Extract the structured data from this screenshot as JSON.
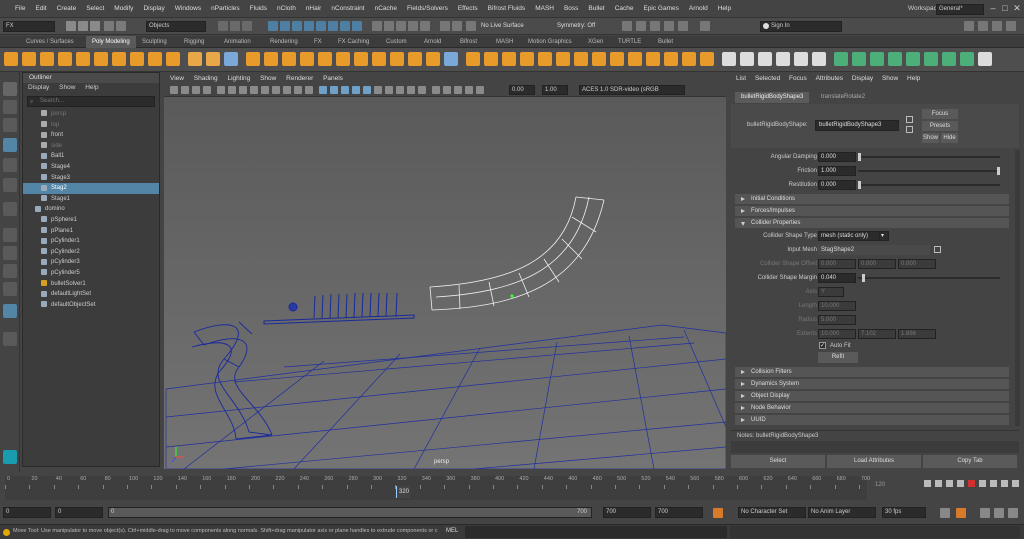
{
  "menubar": {
    "items": [
      "File",
      "Edit",
      "Create",
      "Select",
      "Modify",
      "Display",
      "Windows",
      "nParticles",
      "Fluids",
      "nCloth",
      "nHair",
      "nConstraint",
      "nCache",
      "Fields/Solvers",
      "Effects",
      "Bifrost Fluids",
      "MASH",
      "Boss",
      "Bullet",
      "Cache",
      "Epic Games",
      "Arnold",
      "Help"
    ],
    "workspace_label": "Workspace :",
    "workspace_value": "General*"
  },
  "statusline": {
    "mode": "FX",
    "selection_mode": "Objects",
    "live_surface": "No Live Surface",
    "symmetry": "Symmetry: Off",
    "signin": "Sign In"
  },
  "shelf": {
    "tabs": [
      "Curves / Surfaces",
      "Poly Modeling",
      "Sculpting",
      "Rigging",
      "Animation",
      "Rendering",
      "FX",
      "FX Caching",
      "Custom",
      "Arnold",
      "Bifrost",
      "MASH",
      "Motion Graphics",
      "XGen",
      "TURTLE",
      "Bullet"
    ],
    "active_tab": "Poly Modeling"
  },
  "outliner": {
    "title": "Outliner",
    "menu": [
      "Display",
      "Show",
      "Help"
    ],
    "search_placeholder": "Search...",
    "items": [
      {
        "label": "persp",
        "state": "dim"
      },
      {
        "label": "top",
        "state": "dim"
      },
      {
        "label": "front",
        "state": "normal"
      },
      {
        "label": "side",
        "state": "dim"
      },
      {
        "label": "Ball1",
        "state": "normal"
      },
      {
        "label": "Stage4",
        "state": "normal"
      },
      {
        "label": "Stage3",
        "state": "normal"
      },
      {
        "label": "Stag2",
        "state": "selected"
      },
      {
        "label": "Stage1",
        "state": "normal"
      },
      {
        "label": "domino",
        "state": "normal"
      },
      {
        "label": "pSphere1",
        "state": "normal"
      },
      {
        "label": "pPlane1",
        "state": "normal"
      },
      {
        "label": "pCylinder1",
        "state": "normal"
      },
      {
        "label": "pCylinder2",
        "state": "normal"
      },
      {
        "label": "pCylinder3",
        "state": "normal"
      },
      {
        "label": "pCylinder5",
        "state": "normal"
      },
      {
        "label": "bulletSolver1",
        "state": "normal"
      },
      {
        "label": "defaultLightSet",
        "state": "normal"
      },
      {
        "label": "defaultObjectSet",
        "state": "normal"
      }
    ]
  },
  "viewport": {
    "menu": [
      "View",
      "Shading",
      "Lighting",
      "Show",
      "Renderer",
      "Panels"
    ],
    "field_a": "0.00",
    "field_b": "1.00",
    "colorspace": "ACES 1.0 SDR-video (sRGB",
    "camera_label": "persp"
  },
  "attribute_editor": {
    "menu": [
      "List",
      "Selected",
      "Focus",
      "Attributes",
      "Display",
      "Show",
      "Help"
    ],
    "tabs": [
      "bulletRigidBodyShape3",
      "translateRotate2"
    ],
    "node_label": "bulletRigidBodyShape:",
    "node_value": "bulletRigidBodyShape3",
    "focus_btn": "Focus",
    "presets_btn": "Presets",
    "show_btn": "Show",
    "hide_btn": "Hide",
    "angular_damping_label": "Angular Damping",
    "angular_damping": "0.000",
    "friction_label": "Friction",
    "friction": "1.000",
    "restitution_label": "Restitution",
    "restitution": "0.000",
    "sections_top": [
      "Initial Conditions",
      "Forces/Impulses",
      "Collider Properties"
    ],
    "collider_shape_type_label": "Collider Shape Type",
    "collider_shape_type": "mesh (static only)",
    "input_mesh_label": "Input Mesh",
    "input_mesh": "StagShape2",
    "collider_offset_label": "Collider Shape Offset",
    "collider_offset": [
      "0.000",
      "0.000",
      "0.000"
    ],
    "collider_margin_label": "Collider Shape Margin",
    "collider_margin": "0.040",
    "axis_label": "Axis",
    "axis_value": "Y",
    "length_label": "Length",
    "length": "10.000",
    "radius_label": "Radius",
    "radius": "5.000",
    "extents_label": "Extents",
    "extents": [
      "10.000",
      "7.102",
      "1.886"
    ],
    "auto_fit": "Auto Fit",
    "refit": "Refit",
    "sections_bottom": [
      "Collision Filters",
      "Dynamics System",
      "Object Display",
      "Node Behavior",
      "UUID"
    ],
    "notes": "Notes: bulletRigidBodyShape3",
    "select_btn": "Select",
    "load_btn": "Load Attributes",
    "copy_btn": "Copy Tab"
  },
  "timeslider": {
    "ticks": [
      "0",
      "20",
      "40",
      "60",
      "80",
      "100",
      "120",
      "140",
      "160",
      "180",
      "200",
      "220",
      "240",
      "260",
      "280",
      "300",
      "320",
      "340",
      "360",
      "380",
      "400",
      "420",
      "440",
      "460",
      "480",
      "500",
      "520",
      "540",
      "560",
      "580",
      "600",
      "620",
      "640",
      "660",
      "680",
      "700"
    ],
    "current": "320",
    "side_value": "120"
  },
  "range": {
    "start": "0",
    "anim_start": "0",
    "playback_start": "0",
    "playback_end": "700",
    "range_end_inner": "700",
    "anim_end": "700",
    "character_set": "No Character Set",
    "anim_layer": "No Anim Layer",
    "fps": "30 fps"
  },
  "help_line": "Move Tool: Use manipulator to move object(s). Ctrl+middle-drag to move components along normals. Shift+drag manipulator axis or plane handles to extrude components or c",
  "cmd_label": "MEL"
}
